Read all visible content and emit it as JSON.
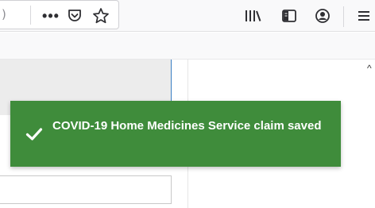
{
  "browser": {
    "url_fragment": ")",
    "page_actions_label": "•••",
    "icons": {
      "page_actions": "more-icon",
      "pocket": "pocket-icon",
      "bookmark": "star-icon",
      "library": "library-icon",
      "sidebar": "sidebar-icon",
      "account": "account-icon",
      "menu": "hamburger-menu-icon"
    }
  },
  "toast": {
    "message": "COVID-19 Home Medicines Service claim saved",
    "icon": "checkmark-icon",
    "background": "#3f8c3b"
  },
  "page": {
    "scroll_indicator": "^"
  }
}
